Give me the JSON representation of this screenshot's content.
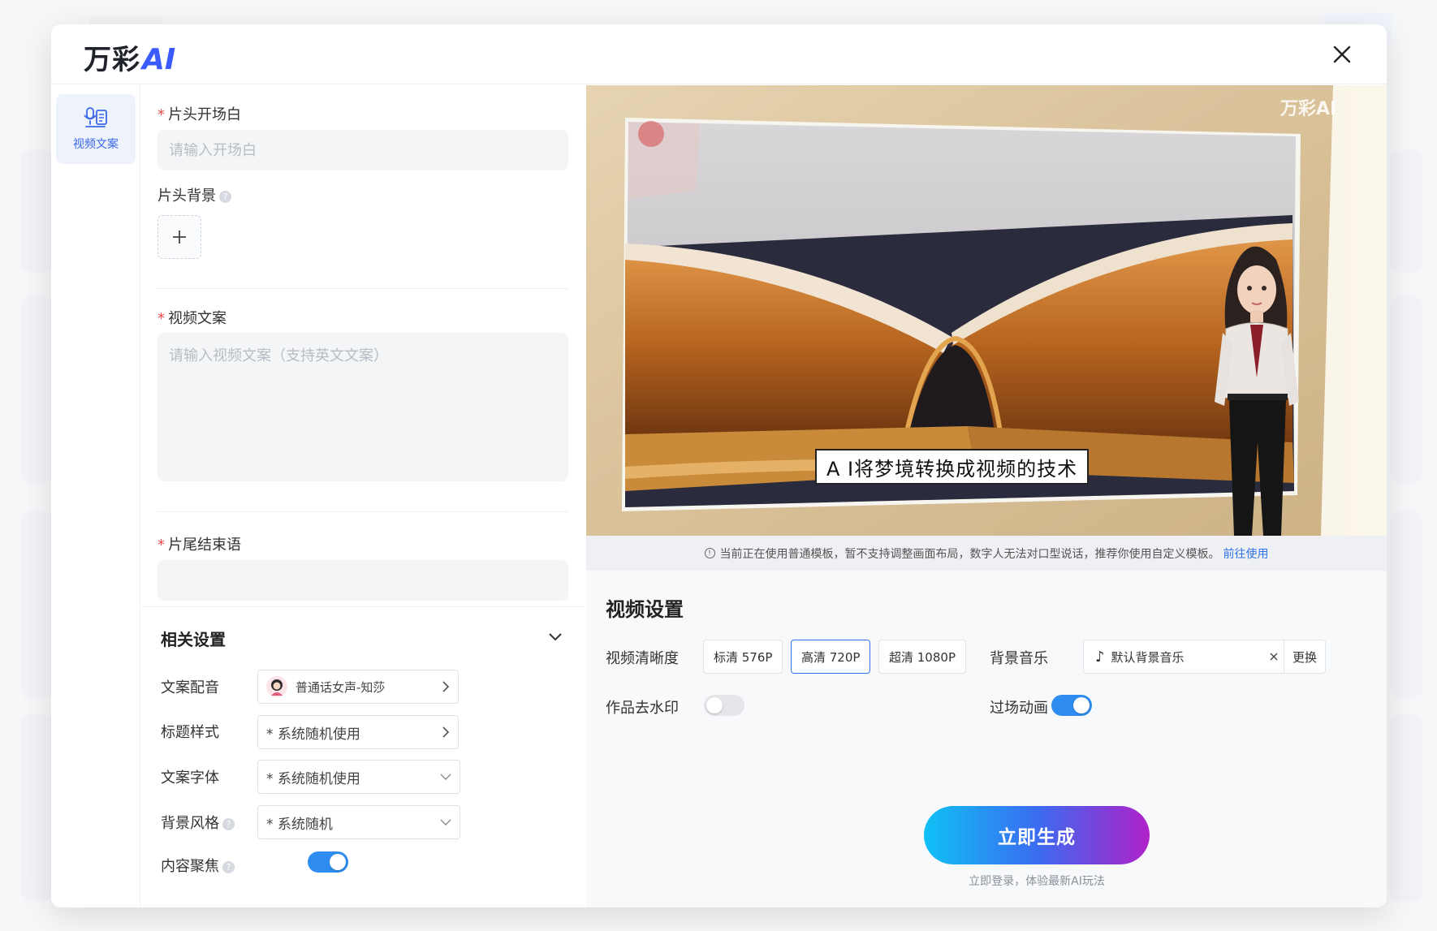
{
  "app": {
    "logo_text": "万彩",
    "logo_ai": "AI"
  },
  "nav": {
    "items": [
      {
        "label": "视频文案",
        "icon": "script-mic-icon",
        "active": true
      }
    ]
  },
  "form": {
    "intro": {
      "label": "片头开场白",
      "placeholder": "请输入开场白"
    },
    "intro_bg": {
      "label": "片头背景"
    },
    "script": {
      "label": "视频文案",
      "placeholder": "请输入视频文案（支持英文文案）"
    },
    "outro": {
      "label": "片尾结束语"
    }
  },
  "related_settings": {
    "title": "相关设置",
    "voice": {
      "label": "文案配音",
      "value": "普通话女声-知莎"
    },
    "title_style": {
      "label": "标题样式",
      "value": "* 系统随机使用"
    },
    "font": {
      "label": "文案字体",
      "value": "* 系统随机使用"
    },
    "bg_style": {
      "label": "背景风格",
      "value": "* 系统随机"
    },
    "focus": {
      "label": "内容聚焦",
      "enabled": true
    }
  },
  "preview": {
    "subtitle": "A I将梦境转换成视频的技术",
    "watermark": "万彩AI"
  },
  "notice": {
    "text": "当前正在使用普通模板，暂不支持调整画面布局，数字人无法对口型说话，推荐你使用自定义模板。",
    "link": "前往使用"
  },
  "video_settings": {
    "title": "视频设置",
    "resolution_label": "视频清晰度",
    "resolutions": [
      "标清 576P",
      "高清 720P",
      "超清 1080P"
    ],
    "selected_resolution": "高清 720P",
    "music_label": "背景音乐",
    "music_value": "默认背景音乐",
    "music_change": "更换",
    "watermark_label": "作品去水印",
    "watermark_enabled": false,
    "transition_label": "过场动画",
    "transition_enabled": true
  },
  "actions": {
    "generate": "立即生成",
    "login_tip": "立即登录，体验最新AI玩法"
  },
  "colors": {
    "accent": "#2f74e8",
    "toggle_on": "#2f8cf0",
    "required": "#f04a4a",
    "generate_gradient_start": "#0fc1f5",
    "generate_gradient_end": "#b021c9"
  }
}
